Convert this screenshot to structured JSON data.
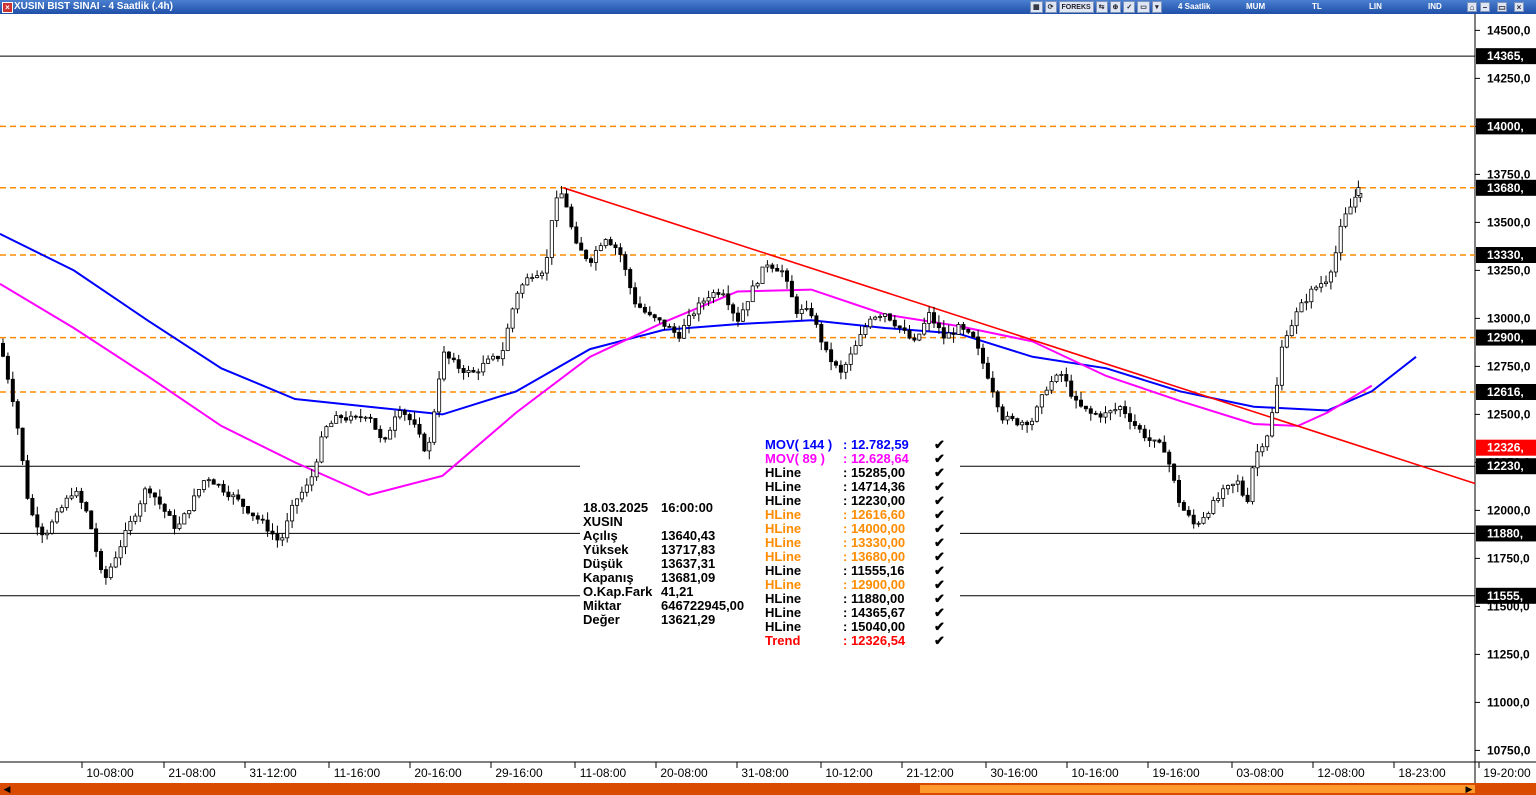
{
  "window": {
    "title": "XUSIN BIST SINAI - 4 Saatlik (.4h)"
  },
  "toolbar": {
    "tab_period": "4 Saatlik",
    "tab_type": "MUM",
    "tab_currency": "TL",
    "tab_scale": "LIN",
    "tab_kind": "IND",
    "forex_label": "FOREKS"
  },
  "info": {
    "date": "18.03.2025",
    "time": "16:00:00",
    "symbol": "XUSIN",
    "rows": [
      {
        "label": "Açılış",
        "value": "13640,43"
      },
      {
        "label": "Yüksek",
        "value": "13717,83"
      },
      {
        "label": "Düşük",
        "value": "13637,31"
      },
      {
        "label": "Kapanış",
        "value": "13681,09"
      },
      {
        "label": "O.Kap.Fark",
        "value": "41,21"
      },
      {
        "label": "Miktar",
        "value": "646722945,00"
      },
      {
        "label": "Değer",
        "value": "13621,29"
      }
    ]
  },
  "legend": [
    {
      "name": "MOV( 144 )",
      "value": ": 12.782,59",
      "color": "#0000ff"
    },
    {
      "name": "MOV( 89 )",
      "value": ": 12.628,64",
      "color": "#ff00ff"
    },
    {
      "name": "HLine",
      "value": ": 15285,00",
      "color": "#000000"
    },
    {
      "name": "HLine",
      "value": ": 14714,36",
      "color": "#000000"
    },
    {
      "name": "HLine",
      "value": ": 12230,00",
      "color": "#000000"
    },
    {
      "name": "HLine",
      "value": ": 12616,60",
      "color": "#ff8c00"
    },
    {
      "name": "HLine",
      "value": ": 14000,00",
      "color": "#ff8c00"
    },
    {
      "name": "HLine",
      "value": ": 13330,00",
      "color": "#ff8c00"
    },
    {
      "name": "HLine",
      "value": ": 13680,00",
      "color": "#ff8c00"
    },
    {
      "name": "HLine",
      "value": ": 11555,16",
      "color": "#000000"
    },
    {
      "name": "HLine",
      "value": ": 12900,00",
      "color": "#ff8c00"
    },
    {
      "name": "HLine",
      "value": ": 11880,00",
      "color": "#000000"
    },
    {
      "name": "HLine",
      "value": ": 14365,67",
      "color": "#000000"
    },
    {
      "name": "HLine",
      "value": ": 15040,00",
      "color": "#000000"
    },
    {
      "name": "Trend",
      "value": ": 12326,54",
      "color": "#ff0000"
    }
  ],
  "chart_data": {
    "type": "candlestick",
    "title": "XUSIN BIST SINAI - 4 Saatlik (.4h)",
    "ylim": [
      10700,
      14580
    ],
    "y_ticks": [
      "14500,0",
      "14250,0",
      "14000,0",
      "13750,0",
      "13500,0",
      "13250,0",
      "13000,0",
      "12750,0",
      "12500,0",
      "12250,0",
      "12000,0",
      "11750,0",
      "11500,0",
      "11250,0",
      "11000,0",
      "10750,0"
    ],
    "x_ticks": [
      "10-08:00",
      "21-08:00",
      "31-12:00",
      "11-16:00",
      "20-16:00",
      "29-16:00",
      "11-08:00",
      "20-08:00",
      "31-08:00",
      "10-12:00",
      "21-12:00",
      "30-16:00",
      "10-16:00",
      "19-16:00",
      "03-08:00",
      "12-08:00",
      "18-23:00",
      "19-20:00"
    ],
    "last_bar": {
      "open": 13640.43,
      "high": 13717.83,
      "low": 13637.31,
      "close": 13681.09
    },
    "hlines": [
      {
        "value": 14365.67,
        "label": "14365,",
        "style": "solid",
        "color": "#000000"
      },
      {
        "value": 14000,
        "label": "14000,",
        "style": "dashed",
        "color": "#ff8c00"
      },
      {
        "value": 13680,
        "label": "13680,",
        "style": "dashed",
        "color": "#ff8c00"
      },
      {
        "value": 13330,
        "label": "13330,",
        "style": "dashed",
        "color": "#ff8c00"
      },
      {
        "value": 12900,
        "label": "12900,",
        "style": "dashed",
        "color": "#ff8c00"
      },
      {
        "value": 12616.6,
        "label": "12616,",
        "style": "dashed",
        "color": "#ff8c00"
      },
      {
        "value": 12230,
        "label": "12230,",
        "style": "solid",
        "color": "#000000"
      },
      {
        "value": 11880,
        "label": "11880,",
        "style": "solid",
        "color": "#000000"
      },
      {
        "value": 11555.16,
        "label": "11555,",
        "style": "solid",
        "color": "#000000"
      }
    ],
    "trend_label": {
      "value": 12326.54,
      "label": "12326,",
      "color": "#ff0000"
    },
    "trendline": {
      "color": "#ff0000",
      "points": [
        [
          0.382,
          13680
        ],
        [
          1.0,
          12140
        ]
      ]
    },
    "mov144": {
      "name": "MOV( 144 )",
      "color": "#0000ff",
      "points": [
        [
          0.0,
          13440
        ],
        [
          0.05,
          13250
        ],
        [
          0.1,
          12990
        ],
        [
          0.15,
          12740
        ],
        [
          0.2,
          12580
        ],
        [
          0.25,
          12540
        ],
        [
          0.3,
          12500
        ],
        [
          0.35,
          12620
        ],
        [
          0.4,
          12840
        ],
        [
          0.45,
          12940
        ],
        [
          0.5,
          12970
        ],
        [
          0.55,
          12990
        ],
        [
          0.6,
          12950
        ],
        [
          0.65,
          12920
        ],
        [
          0.7,
          12800
        ],
        [
          0.75,
          12740
        ],
        [
          0.8,
          12620
        ],
        [
          0.85,
          12540
        ],
        [
          0.9,
          12520
        ],
        [
          0.93,
          12620
        ],
        [
          0.96,
          12800
        ]
      ]
    },
    "mov89": {
      "name": "MOV( 89 )",
      "color": "#ff00ff",
      "points": [
        [
          0.0,
          13180
        ],
        [
          0.05,
          12950
        ],
        [
          0.1,
          12700
        ],
        [
          0.15,
          12440
        ],
        [
          0.2,
          12250
        ],
        [
          0.25,
          12080
        ],
        [
          0.3,
          12180
        ],
        [
          0.35,
          12510
        ],
        [
          0.4,
          12800
        ],
        [
          0.45,
          12980
        ],
        [
          0.5,
          13140
        ],
        [
          0.55,
          13150
        ],
        [
          0.6,
          13020
        ],
        [
          0.65,
          12960
        ],
        [
          0.7,
          12880
        ],
        [
          0.75,
          12700
        ],
        [
          0.8,
          12570
        ],
        [
          0.85,
          12450
        ],
        [
          0.88,
          12440
        ],
        [
          0.9,
          12510
        ],
        [
          0.93,
          12650
        ]
      ]
    },
    "price_path": [
      [
        0.0,
        12870
      ],
      [
        0.01,
        12540
      ],
      [
        0.02,
        12000
      ],
      [
        0.03,
        11870
      ],
      [
        0.05,
        12110
      ],
      [
        0.06,
        11970
      ],
      [
        0.07,
        11620
      ],
      [
        0.08,
        11790
      ],
      [
        0.1,
        12130
      ],
      [
        0.12,
        11900
      ],
      [
        0.14,
        12180
      ],
      [
        0.16,
        12060
      ],
      [
        0.18,
        11920
      ],
      [
        0.19,
        11830
      ],
      [
        0.2,
        12050
      ],
      [
        0.21,
        12140
      ],
      [
        0.22,
        12420
      ],
      [
        0.23,
        12490
      ],
      [
        0.24,
        12470
      ],
      [
        0.25,
        12510
      ],
      [
        0.26,
        12330
      ],
      [
        0.27,
        12550
      ],
      [
        0.28,
        12450
      ],
      [
        0.29,
        12290
      ],
      [
        0.3,
        12820
      ],
      [
        0.31,
        12750
      ],
      [
        0.32,
        12710
      ],
      [
        0.33,
        12770
      ],
      [
        0.34,
        12810
      ],
      [
        0.35,
        13130
      ],
      [
        0.36,
        13230
      ],
      [
        0.37,
        13260
      ],
      [
        0.375,
        13580
      ],
      [
        0.382,
        13660
      ],
      [
        0.39,
        13380
      ],
      [
        0.4,
        13300
      ],
      [
        0.41,
        13430
      ],
      [
        0.42,
        13350
      ],
      [
        0.43,
        13090
      ],
      [
        0.44,
        13010
      ],
      [
        0.45,
        12970
      ],
      [
        0.46,
        12910
      ],
      [
        0.47,
        13030
      ],
      [
        0.48,
        13120
      ],
      [
        0.49,
        13150
      ],
      [
        0.5,
        12990
      ],
      [
        0.51,
        13150
      ],
      [
        0.52,
        13290
      ],
      [
        0.53,
        13250
      ],
      [
        0.54,
        13040
      ],
      [
        0.55,
        13030
      ],
      [
        0.56,
        12820
      ],
      [
        0.57,
        12710
      ],
      [
        0.58,
        12850
      ],
      [
        0.59,
        13010
      ],
      [
        0.6,
        13030
      ],
      [
        0.61,
        12950
      ],
      [
        0.62,
        12870
      ],
      [
        0.63,
        13020
      ],
      [
        0.64,
        12900
      ],
      [
        0.65,
        12950
      ],
      [
        0.66,
        12890
      ],
      [
        0.67,
        12700
      ],
      [
        0.68,
        12480
      ],
      [
        0.69,
        12460
      ],
      [
        0.7,
        12470
      ],
      [
        0.71,
        12650
      ],
      [
        0.72,
        12710
      ],
      [
        0.73,
        12550
      ],
      [
        0.74,
        12500
      ],
      [
        0.75,
        12500
      ],
      [
        0.76,
        12540
      ],
      [
        0.77,
        12440
      ],
      [
        0.78,
        12360
      ],
      [
        0.79,
        12320
      ],
      [
        0.8,
        12030
      ],
      [
        0.81,
        11920
      ],
      [
        0.82,
        12010
      ],
      [
        0.83,
        12100
      ],
      [
        0.84,
        12150
      ],
      [
        0.845,
        12020
      ],
      [
        0.85,
        12270
      ],
      [
        0.86,
        12410
      ],
      [
        0.865,
        12600
      ],
      [
        0.87,
        12900
      ],
      [
        0.875,
        12960
      ],
      [
        0.88,
        13040
      ],
      [
        0.89,
        13150
      ],
      [
        0.9,
        13210
      ],
      [
        0.905,
        13320
      ],
      [
        0.91,
        13500
      ],
      [
        0.915,
        13570
      ],
      [
        0.92,
        13650
      ],
      [
        0.925,
        13690
      ]
    ],
    "x_span_end": 0.925
  }
}
